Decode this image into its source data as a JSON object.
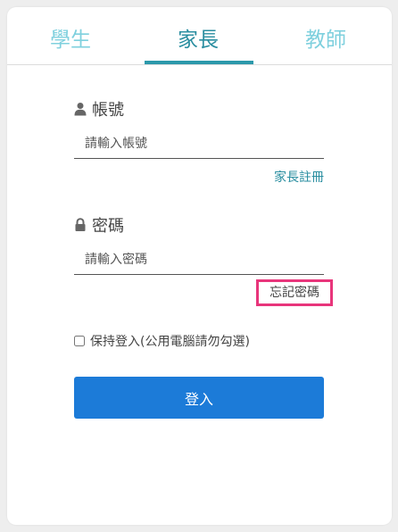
{
  "tabs": {
    "student": "學生",
    "parent": "家長",
    "teacher": "教師",
    "active": "家長"
  },
  "account": {
    "label": "帳號",
    "icon": "user-icon",
    "placeholder": "請輸入帳號"
  },
  "register_link": "家長註冊",
  "password": {
    "label": "密碼",
    "icon": "lock-icon",
    "placeholder": "請輸入密碼"
  },
  "forgot_password": "忘記密碼",
  "remember_me": "保持登入(公用電腦請勿勾選)",
  "login_button": "登入",
  "colors": {
    "active_tab": "#2a8ea0",
    "inactive_tab": "#7fd0de",
    "button": "#1c7bd8",
    "highlight_border": "#e8357b"
  }
}
